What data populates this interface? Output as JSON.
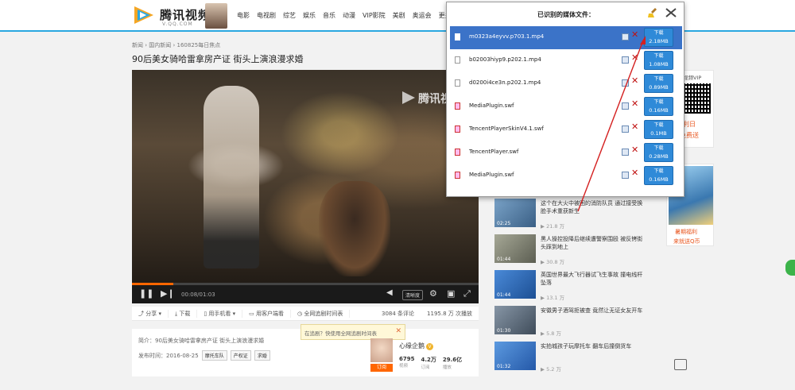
{
  "header": {
    "logo_text": "腾讯视频",
    "logo_sub": "V.QQ.COM",
    "nav": [
      "电影",
      "电视剧",
      "综艺",
      "娱乐",
      "音乐",
      "动漫",
      "VIP影院",
      "美剧",
      "奥运会",
      "更多"
    ]
  },
  "breadcrumb": "新闻 › 国内新闻 › 160825每日焦点",
  "video": {
    "title": "90后美女骑哈雷拿房产证 街头上演浪漫求婚",
    "watermark": "腾讯视",
    "time": "00:08/01:03",
    "clarity": "清晰度",
    "progress": 0.12
  },
  "toolbar": {
    "share": "分享",
    "download": "下载",
    "phone": "用手机看",
    "client": "用客户端看",
    "follow": "全网追剧时间表",
    "stats": "3084 条评论",
    "plays": "1195.8 万 次播放"
  },
  "info": {
    "intro_label": "简介：",
    "intro": "90后美女骑哈雷拿房产证 街头上演浪漫求婚",
    "pub_label": "发布时间：",
    "pub_date": "2016-08-25",
    "tags": [
      "摩托车队",
      "产权证",
      "求婚"
    ]
  },
  "tip": {
    "text": "在追剧？快使用全网追剧时间表",
    "close": "✕"
  },
  "channel": {
    "name": "心缘企鹅",
    "subscribe": "订阅",
    "badge": "V",
    "stats": [
      {
        "value": "6795",
        "label": "视频"
      },
      {
        "value": "4.2万",
        "label": "订阅"
      },
      {
        "value": "29.6亿",
        "label": "播放"
      }
    ]
  },
  "popup": {
    "title": "已识别的媒体文件：",
    "download_label": "下载",
    "files": [
      {
        "name": "m0323a4eyvv.p703.1.mp4",
        "size": "2.18MB",
        "kind": "mp4",
        "selected": true
      },
      {
        "name": "b02003hiyp9.p202.1.mp4",
        "size": "1.08MB",
        "kind": "mp4",
        "selected": false
      },
      {
        "name": "d0200i4ce3n.p202.1.mp4",
        "size": "0.89MB",
        "kind": "mp4",
        "selected": false
      },
      {
        "name": "MediaPlugin.swf",
        "size": "0.16MB",
        "kind": "swf",
        "selected": false
      },
      {
        "name": "TencentPlayerSkinV4.1.swf",
        "size": "0.1MB",
        "kind": "swf",
        "selected": false
      },
      {
        "name": "TencentPlayer.swf",
        "size": "0.28MB",
        "kind": "swf",
        "selected": false
      },
      {
        "name": "MediaPlugin.swf",
        "size": "0.16MB",
        "kind": "swf",
        "selected": false
      }
    ]
  },
  "related": [
    {
      "title": "这个在大火中被困的消防队员 通过接受换脸手术重获新生",
      "duration": "02:25",
      "plays": "21.8 万",
      "color": "#5a8fc0"
    },
    {
      "title": "黑人操控投降后继续遭警察围殴 被反铐街头踩到地上",
      "duration": "01:44",
      "plays": "30.8 万",
      "color": "#8a8a7a"
    },
    {
      "title": "英国世界最大飞行器试飞生事故 撞电线杆坠落",
      "duration": "01:44",
      "plays": "13.1 万",
      "color": "#2c6fc0"
    },
    {
      "title": "安徽男子酒驾拒被查 竟然让无证女友开车",
      "duration": "01:30",
      "plays": "5.8 万",
      "color": "#6a7a8a"
    },
    {
      "title": "实拍城孩子玩摩托车 翻车后撞倒货车",
      "duration": "01:32",
      "plays": "5.2 万",
      "color": "#3a7cc8"
    }
  ],
  "side": {
    "vip_title": "视频VIP",
    "vip_line1": "利日",
    "vip_line2": "免费送",
    "promo_line1": "暑期福利",
    "promo_line2": "来就送Q币"
  }
}
